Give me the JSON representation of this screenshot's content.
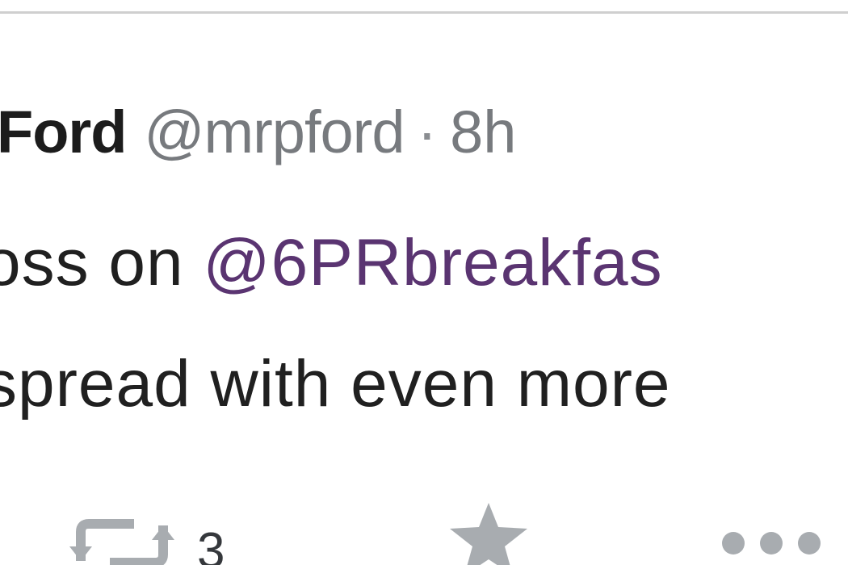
{
  "tweet": {
    "author_name": "Ford",
    "author_handle": "@mrpford",
    "separator": "·",
    "timestamp": "8h",
    "text_line_1_prefix": "oss on ",
    "text_line_1_mention": "@6PRbreakfas",
    "text_line_2": "spread with even more"
  },
  "actions": {
    "retweet_icon": "retweet-icon",
    "retweet_count": "3",
    "favorite_icon": "star-icon",
    "more_icon": "more-dots-icon"
  },
  "colors": {
    "mention": "#5a3471",
    "handle": "#777a7e",
    "text": "#202020",
    "icon": "#a0a4a8",
    "top_border": "#cfcfcf"
  }
}
